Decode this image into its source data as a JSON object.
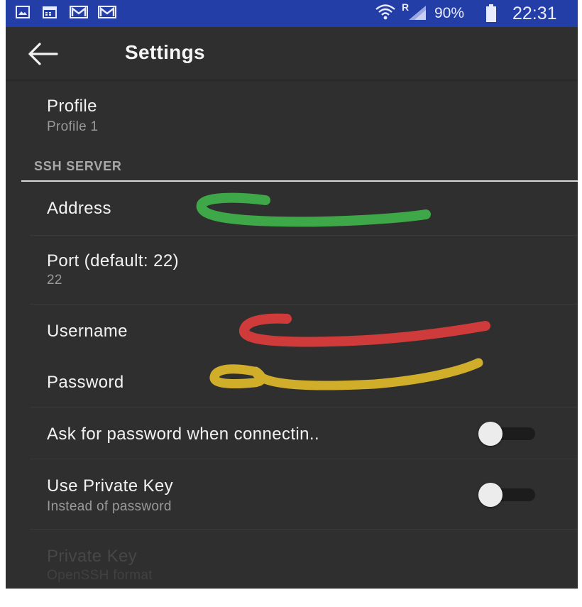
{
  "status_bar": {
    "notification_icons": [
      "gallery-icon",
      "calendar-icon",
      "gmail-icon",
      "gmail-icon"
    ],
    "battery": "90%",
    "time": "22:31",
    "roaming": "R",
    "color": "#243ea8"
  },
  "app_bar": {
    "title": "Settings"
  },
  "preferences": {
    "profile": {
      "title": "Profile",
      "summary": "Profile 1"
    },
    "section_ssh": "SSH SERVER",
    "address": {
      "title": "Address"
    },
    "port": {
      "title": "Port (default: 22)",
      "summary": "22"
    },
    "username": {
      "title": "Username"
    },
    "password": {
      "title": "Password"
    },
    "ask_password": {
      "title": "Ask for password when connectin..",
      "checked": false
    },
    "private_key_toggle": {
      "title": "Use Private Key",
      "summary": "Instead of password",
      "checked": false
    },
    "private_key": {
      "title": "Private Key",
      "summary": "OpenSSH format",
      "enabled": false
    }
  },
  "redaction_colors": {
    "address": "#3fae49",
    "username": "#d83c3c",
    "password": "#d9b52a"
  }
}
